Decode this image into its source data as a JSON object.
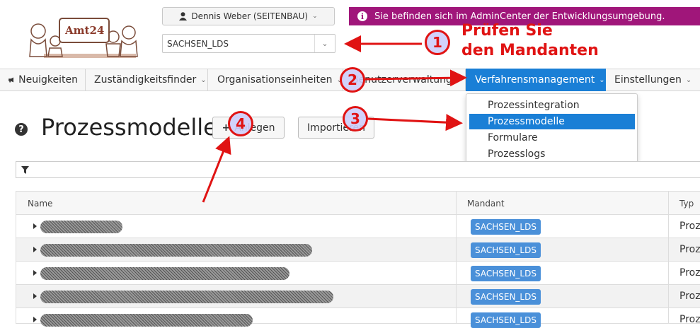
{
  "header": {
    "user_button_label": "Dennis Weber (SEITENBAU)",
    "tenant_value": "SACHSEN_LDS",
    "env_banner_text": "Sie befinden sich im AdminCenter der Entwicklungsumgebung.",
    "logo_text": "Amt24"
  },
  "nav": {
    "items": [
      {
        "label": "Neuigkeiten"
      },
      {
        "label": "Zuständigkeitsfinder"
      },
      {
        "label": "Organisationseinheiten"
      },
      {
        "label": "Benutzerverwaltung"
      },
      {
        "label": "Verfahrensmanagement"
      },
      {
        "label": "Einstellungen"
      }
    ],
    "active_index": 4
  },
  "dropdown": {
    "items": [
      {
        "label": "Prozessintegration"
      },
      {
        "label": "Prozessmodelle"
      },
      {
        "label": "Formulare"
      },
      {
        "label": "Prozesslogs"
      }
    ],
    "selected_index": 1
  },
  "page": {
    "title": "Prozessmodelle",
    "create_button": "Anlegen",
    "import_button": "Importieren"
  },
  "table": {
    "columns": [
      "Name",
      "Mandant",
      "Typ"
    ],
    "rows": [
      {
        "mandant": "SACHSEN_LDS",
        "typ": "Proz"
      },
      {
        "mandant": "SACHSEN_LDS",
        "typ": "Proz"
      },
      {
        "mandant": "SACHSEN_LDS",
        "typ": "Proz"
      },
      {
        "mandant": "SACHSEN_LDS",
        "typ": "Proz"
      },
      {
        "mandant": "SACHSEN_LDS",
        "typ": "Proz"
      }
    ]
  },
  "annotations": {
    "steps": [
      "1",
      "2",
      "3",
      "4"
    ],
    "note_line1": "Prüfen Sie",
    "note_line2": "den Mandanten"
  },
  "colors": {
    "accent": "#1a7fd6",
    "banner": "#a0167a",
    "annotation": "#e01313"
  }
}
